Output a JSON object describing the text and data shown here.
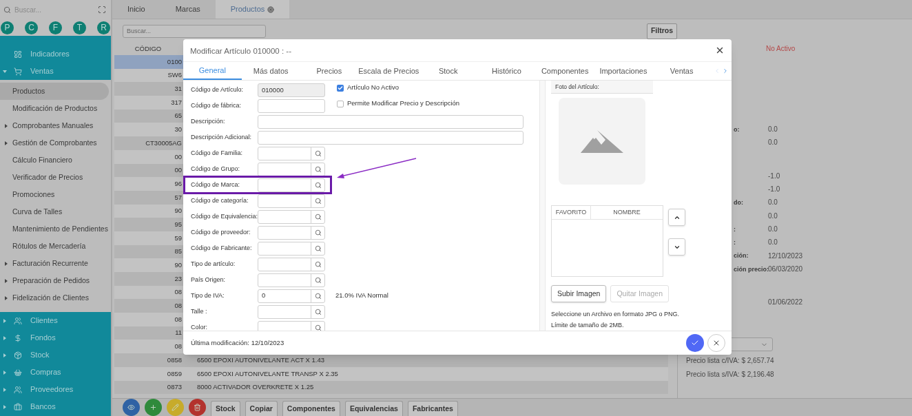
{
  "sidebar": {
    "search": {
      "placeholder": "Buscar..."
    },
    "shortcuts": [
      "P",
      "C",
      "F",
      "T",
      "R"
    ],
    "items": [
      {
        "label": "Indicadores",
        "selected": false
      },
      {
        "label": "Ventas",
        "selected": false,
        "expanded": true,
        "children": [
          {
            "label": "Productos",
            "selected": true
          },
          {
            "label": "Modificación de Productos",
            "selected": false
          },
          {
            "label": "Comprobantes Manuales",
            "selected": false,
            "expanded": false
          },
          {
            "label": "Gestión de Comprobantes",
            "selected": false,
            "expanded": false
          },
          {
            "label": "Cálculo Financiero",
            "selected": false
          },
          {
            "label": "Verificador de Precios",
            "selected": false
          },
          {
            "label": "Promociones",
            "selected": false
          },
          {
            "label": "Curva de Talles",
            "selected": false
          },
          {
            "label": "Mantenimiento de Pendientes",
            "selected": false
          },
          {
            "label": "Rótulos de Mercadería",
            "selected": false
          },
          {
            "label": "Facturación Recurrente",
            "selected": false,
            "expanded": false
          },
          {
            "label": "Preparación de Pedidos",
            "selected": false,
            "expanded": false
          },
          {
            "label": "Fidelización de Clientes",
            "selected": false,
            "expanded": false
          }
        ]
      },
      {
        "label": "Clientes",
        "selected": false,
        "expanded": false
      },
      {
        "label": "Fondos",
        "selected": false,
        "expanded": false
      },
      {
        "label": "Stock",
        "selected": false,
        "expanded": false
      },
      {
        "label": "Compras",
        "selected": false,
        "expanded": false
      },
      {
        "label": "Proveedores",
        "selected": false,
        "expanded": false
      },
      {
        "label": "Bancos",
        "selected": false,
        "expanded": false
      }
    ]
  },
  "tabs": [
    {
      "label": "Inicio",
      "selected": false,
      "closable": false
    },
    {
      "label": "Marcas",
      "selected": false,
      "closable": false
    },
    {
      "label": "Productos",
      "selected": true,
      "closable": true
    }
  ],
  "search": {
    "placeholder": "Buscar..."
  },
  "filter_button": "Filtros",
  "table": {
    "columns": [
      "CÓDIGO"
    ],
    "rows": [
      {
        "cells": [
          "0100"
        ],
        "selected": true
      },
      {
        "cells": [
          "SW6"
        ],
        "selected": false
      },
      {
        "cells": [
          "31"
        ],
        "selected": false
      },
      {
        "cells": [
          "317"
        ],
        "selected": false
      },
      {
        "cells": [
          "65"
        ],
        "selected": false
      },
      {
        "cells": [
          "30"
        ],
        "selected": false
      },
      {
        "cells": [
          "CT30005AG"
        ],
        "selected": false
      },
      {
        "cells": [
          "00"
        ],
        "selected": false
      },
      {
        "cells": [
          "00"
        ],
        "selected": false
      },
      {
        "cells": [
          "96"
        ],
        "selected": false
      },
      {
        "cells": [
          "57"
        ],
        "selected": false
      },
      {
        "cells": [
          "90"
        ],
        "selected": false
      },
      {
        "cells": [
          "95"
        ],
        "selected": false
      },
      {
        "cells": [
          "59"
        ],
        "selected": false
      },
      {
        "cells": [
          "85"
        ],
        "selected": false
      },
      {
        "cells": [
          "90"
        ],
        "selected": false
      },
      {
        "cells": [
          "23"
        ],
        "selected": false
      },
      {
        "cells": [
          "08"
        ],
        "selected": false
      },
      {
        "cells": [
          "08"
        ],
        "selected": false
      },
      {
        "cells": [
          "08"
        ],
        "selected": false
      },
      {
        "cells": [
          "11"
        ],
        "selected": false
      },
      {
        "cells": [
          "08"
        ],
        "selected": false
      },
      {
        "cells": [
          "0858",
          "6500 EPOXI AUTONIVELANTE ACT X 1.43"
        ],
        "selected": false
      },
      {
        "cells": [
          "0859",
          "6500 EPOXI AUTONIVELANTE TRANSP X 2.35"
        ],
        "selected": false
      },
      {
        "cells": [
          "0873",
          "8000 ACTIVADOR OVERKRETE X 1.25"
        ],
        "selected": false
      }
    ]
  },
  "details": {
    "status": "No Activo",
    "groups": [
      [
        {
          "label": "o:",
          "value": "0.0"
        },
        {
          "value": "0.0"
        }
      ],
      [
        {
          "value": "-1.0"
        },
        {
          "value": "-1.0"
        },
        {
          "label": "do:",
          "value": "0.0"
        },
        {
          "value": "0.0"
        },
        {
          "label": ":",
          "value": "0.0"
        },
        {
          "label": ":",
          "value": "0.0"
        },
        {
          "label": "ción:",
          "value": "12/10/2023"
        },
        {
          "label": "ción precio:",
          "value": "06/03/2020"
        }
      ],
      [
        {
          "value": "01/06/2022"
        }
      ]
    ],
    "prices": [
      "Precio lista c/IVA: $ 2,657.74",
      "Precio lista s/IVA: $ 2,196.48"
    ]
  },
  "toolbar": {
    "icon_buttons": [
      {
        "kind": "view"
      },
      {
        "kind": "add"
      },
      {
        "kind": "edit"
      },
      {
        "kind": "delete"
      }
    ],
    "buttons": [
      "Stock",
      "Copiar",
      "Componentes",
      "Equivalencias",
      "Fabricantes"
    ]
  },
  "dialog": {
    "title": "Modificar Artículo 010000 : --",
    "tabs": [
      {
        "label": "General",
        "selected": true
      },
      {
        "label": "Más datos",
        "selected": false
      },
      {
        "label": "Precios",
        "selected": false
      },
      {
        "label": "Escala de Precios",
        "selected": false
      },
      {
        "label": "Stock",
        "selected": false
      },
      {
        "label": "Histórico",
        "selected": false
      },
      {
        "label": "Componentes",
        "selected": false
      },
      {
        "label": "Importaciones",
        "selected": false
      },
      {
        "label": "Ventas",
        "selected": false
      }
    ],
    "fields": [
      {
        "kind": "text",
        "label": "Código de Artículo:",
        "value": "010000",
        "disabled": true,
        "highlighted": false,
        "checkbox": {
          "label": "Artículo No Activo",
          "checked": true
        }
      },
      {
        "kind": "text",
        "label": "Código de fábrica:",
        "disabled": false,
        "highlighted": false,
        "checkbox": {
          "label": "Permite Modificar Precio y Descripción",
          "checked": false
        }
      },
      {
        "kind": "wide",
        "label": "Descripción:",
        "disabled": false,
        "highlighted": false
      },
      {
        "kind": "wide",
        "label": "Descripción Adicional:",
        "disabled": false,
        "highlighted": false
      },
      {
        "kind": "lookup",
        "label": "Código de Familia:",
        "disabled": false,
        "highlighted": false
      },
      {
        "kind": "lookup",
        "label": "Código de Grupo:",
        "disabled": false,
        "highlighted": false
      },
      {
        "kind": "lookup",
        "label": "Código de Marca:",
        "disabled": false,
        "highlighted": true
      },
      {
        "kind": "lookup",
        "label": "Código de categoría:",
        "disabled": false,
        "highlighted": false
      },
      {
        "kind": "lookup",
        "label": "Código de Equivalencia:",
        "disabled": false,
        "highlighted": false
      },
      {
        "kind": "lookup",
        "label": "Código de proveedor:",
        "disabled": false,
        "highlighted": false
      },
      {
        "kind": "lookup",
        "label": "Código de Fabricante:",
        "disabled": false,
        "highlighted": false
      },
      {
        "kind": "lookup",
        "label": "Tipo de artículo:",
        "disabled": false,
        "highlighted": false
      },
      {
        "kind": "lookup",
        "label": "País Origen:",
        "disabled": false,
        "highlighted": false
      },
      {
        "kind": "lookup",
        "label": "Tipo de IVA:",
        "value": "0",
        "note": "21.0% IVA Normal",
        "disabled": false,
        "highlighted": false
      },
      {
        "kind": "lookup",
        "label": "Talle :",
        "disabled": false,
        "highlighted": false
      },
      {
        "kind": "lookup",
        "label": "Color:",
        "disabled": false,
        "highlighted": false
      }
    ],
    "photo_label": "Foto del Artículo:",
    "favorites_table": {
      "columns": [
        "FAVORITO",
        "NOMBRE"
      ]
    },
    "image_buttons": [
      {
        "label": "Subir Imagen",
        "disabled": false
      },
      {
        "label": "Quitar Imagen",
        "disabled": true
      }
    ],
    "help": [
      "Seleccione un Archivo en formato JPG o PNG.",
      "Límite de tamaño de 2MB."
    ],
    "footer": "Última modificación: 12/10/2023"
  }
}
